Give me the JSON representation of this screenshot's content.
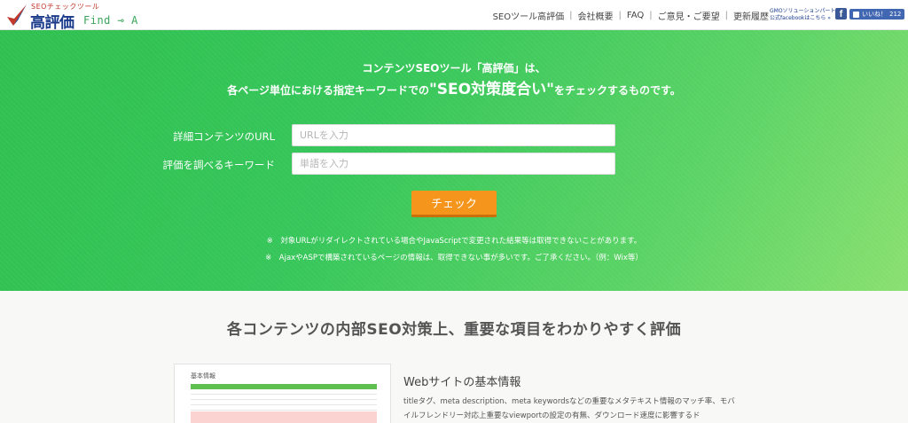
{
  "header": {
    "logo_sub": "SEOチェックツール",
    "logo_main": "高評価",
    "logo_find": "Find",
    "logo_arrow": "⊸",
    "logo_a": "A",
    "nav": [
      {
        "label": "SEOツール高評価"
      },
      {
        "label": "会社概要"
      },
      {
        "label": "FAQ"
      },
      {
        "label": "ご意見・ご要望"
      },
      {
        "label": "更新履歴"
      }
    ],
    "nav_sep": "|",
    "gmo_line1": "GMOソリューションパートナー",
    "gmo_line2": "公式facebookはこちら »",
    "fb_icon": "f",
    "fb_like_label": "いいね！",
    "fb_like_count": "212"
  },
  "hero": {
    "line1": "コンテンツSEOツール「高評価」は、",
    "line2_pre": "各ページ単位における指定キーワードでの",
    "line2_big": "\"SEO対策度合い\"",
    "line2_post": "をチェックするものです。",
    "url_label": "詳細コンテンツのURL",
    "url_placeholder": "URLを入力",
    "keyword_label": "評価を調べるキーワード",
    "keyword_placeholder": "単語を入力",
    "check_button": "チェック",
    "note1": "※　対象URLがリダイレクトされている場合やJavaScriptで変更された結果等は取得できないことがあります。",
    "note2": "※　AjaxやASPで構築されているページの情報は、取得できない事が多いです。ご了承ください。（例：Wix等）"
  },
  "section": {
    "heading": "各コンテンツの内部SEO対策上、重要な項目をわかりやすく評価",
    "preview_title": "基本情報",
    "info_title": "Webサイトの基本情報",
    "info_body": "titleタグ、meta description、meta keywordsなどの重要なメタテキスト情報のマッチ率、モバイルフレンドリー対応上重要なviewportの設定の有無、ダウンロード速度に影響するド"
  },
  "colors": {
    "brand_blue": "#1a3b8c",
    "hero_green": "#36c65a",
    "button_orange": "#f5951b",
    "facebook": "#3b5998"
  }
}
